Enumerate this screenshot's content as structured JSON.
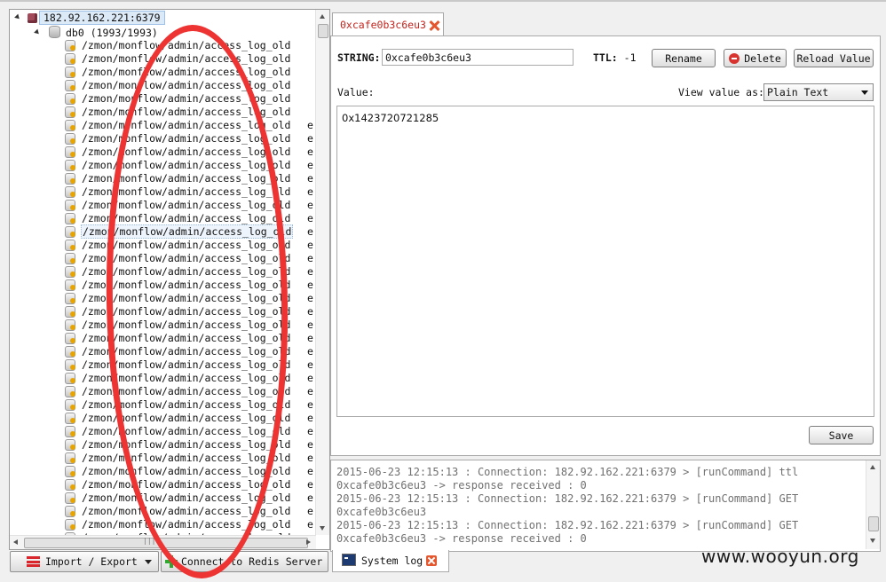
{
  "tree": {
    "server_label": "182.92.162.221:6379",
    "db_label": "db0  (1993/1993)",
    "key_name": "/zmon/monflow/admin/access_log_old",
    "key_tail": "e",
    "visible_key_count": 38,
    "selected_index": 14
  },
  "bottom_bar": {
    "import_export_label": "Import / Export",
    "connect_label": "Connect to Redis Server"
  },
  "key_tab": {
    "label": "0xcafe0b3c6eu3"
  },
  "key_editor": {
    "type_label": "STRING:",
    "key_value": "0xcafe0b3c6eu3",
    "ttl_label": "TTL:",
    "ttl_value": "-1",
    "rename_label": "Rename",
    "delete_label": "Delete",
    "reload_label": "Reload Value",
    "value_label": "Value:",
    "view_as_label": "View value as:",
    "view_as_selected": "Plain Text",
    "value_text": "0x1423720721285",
    "save_label": "Save"
  },
  "log": {
    "lines": [
      "2015-06-23 12:15:13 : Connection: 182.92.162.221:6379 > [runCommand] ttl",
      "0xcafe0b3c6eu3 -> response received : 0",
      "2015-06-23 12:15:13 : Connection: 182.92.162.221:6379 > [runCommand] GET",
      "0xcafe0b3c6eu3",
      "2015-06-23 12:15:13 : Connection: 182.92.162.221:6379 > [runCommand] GET",
      "0xcafe0b3c6eu3 -> response received : 0"
    ],
    "tab_label": "System log"
  },
  "watermark": "www.wooyun.org",
  "colors": {
    "tab_accent": "#c4241d",
    "annotation": "#e33333",
    "selection": "#dce9f7"
  }
}
